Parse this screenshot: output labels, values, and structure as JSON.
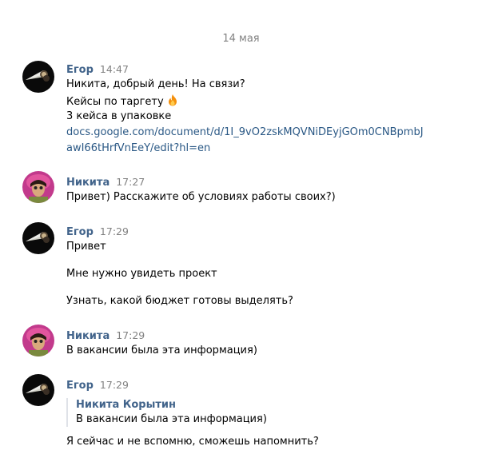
{
  "date_separator": "14 мая",
  "messages": [
    {
      "author": "Егор",
      "time": "14:47",
      "lines": [
        "Никита, добрый день! На связи?",
        "Кейсы по таргету",
        "3 кейса в упаковке"
      ],
      "emoji": "fire-emoji",
      "link_lines": [
        "docs.google.com/document/d/1I_9vO2zskMQVNiDEyjGOm0CNBpmbJ",
        "awI66tHrfVnEeY/edit?hl=en"
      ]
    },
    {
      "author": "Никита",
      "time": "17:27",
      "lines": [
        "Привет) Расскажите об условиях работы своих?)"
      ]
    },
    {
      "author": "Егор",
      "time": "17:29",
      "lines": [
        "Привет",
        "Мне нужно увидеть проект",
        "Узнать, какой бюджет готовы выделять?"
      ]
    },
    {
      "author": "Никита",
      "time": "17:29",
      "lines": [
        "В вакансии была эта информация)"
      ]
    },
    {
      "author": "Егор",
      "time": "17:29",
      "quote": {
        "author": "Никита Корытин",
        "text": "В вакансии была эта информация)"
      },
      "lines": [
        "Я сейчас и не вспомню, сможешь напомнить?"
      ]
    }
  ],
  "colors": {
    "author_name": "#42648b",
    "link": "#2a5885",
    "meta_gray": "#828282",
    "quote_bar": "#dfe2e8"
  }
}
